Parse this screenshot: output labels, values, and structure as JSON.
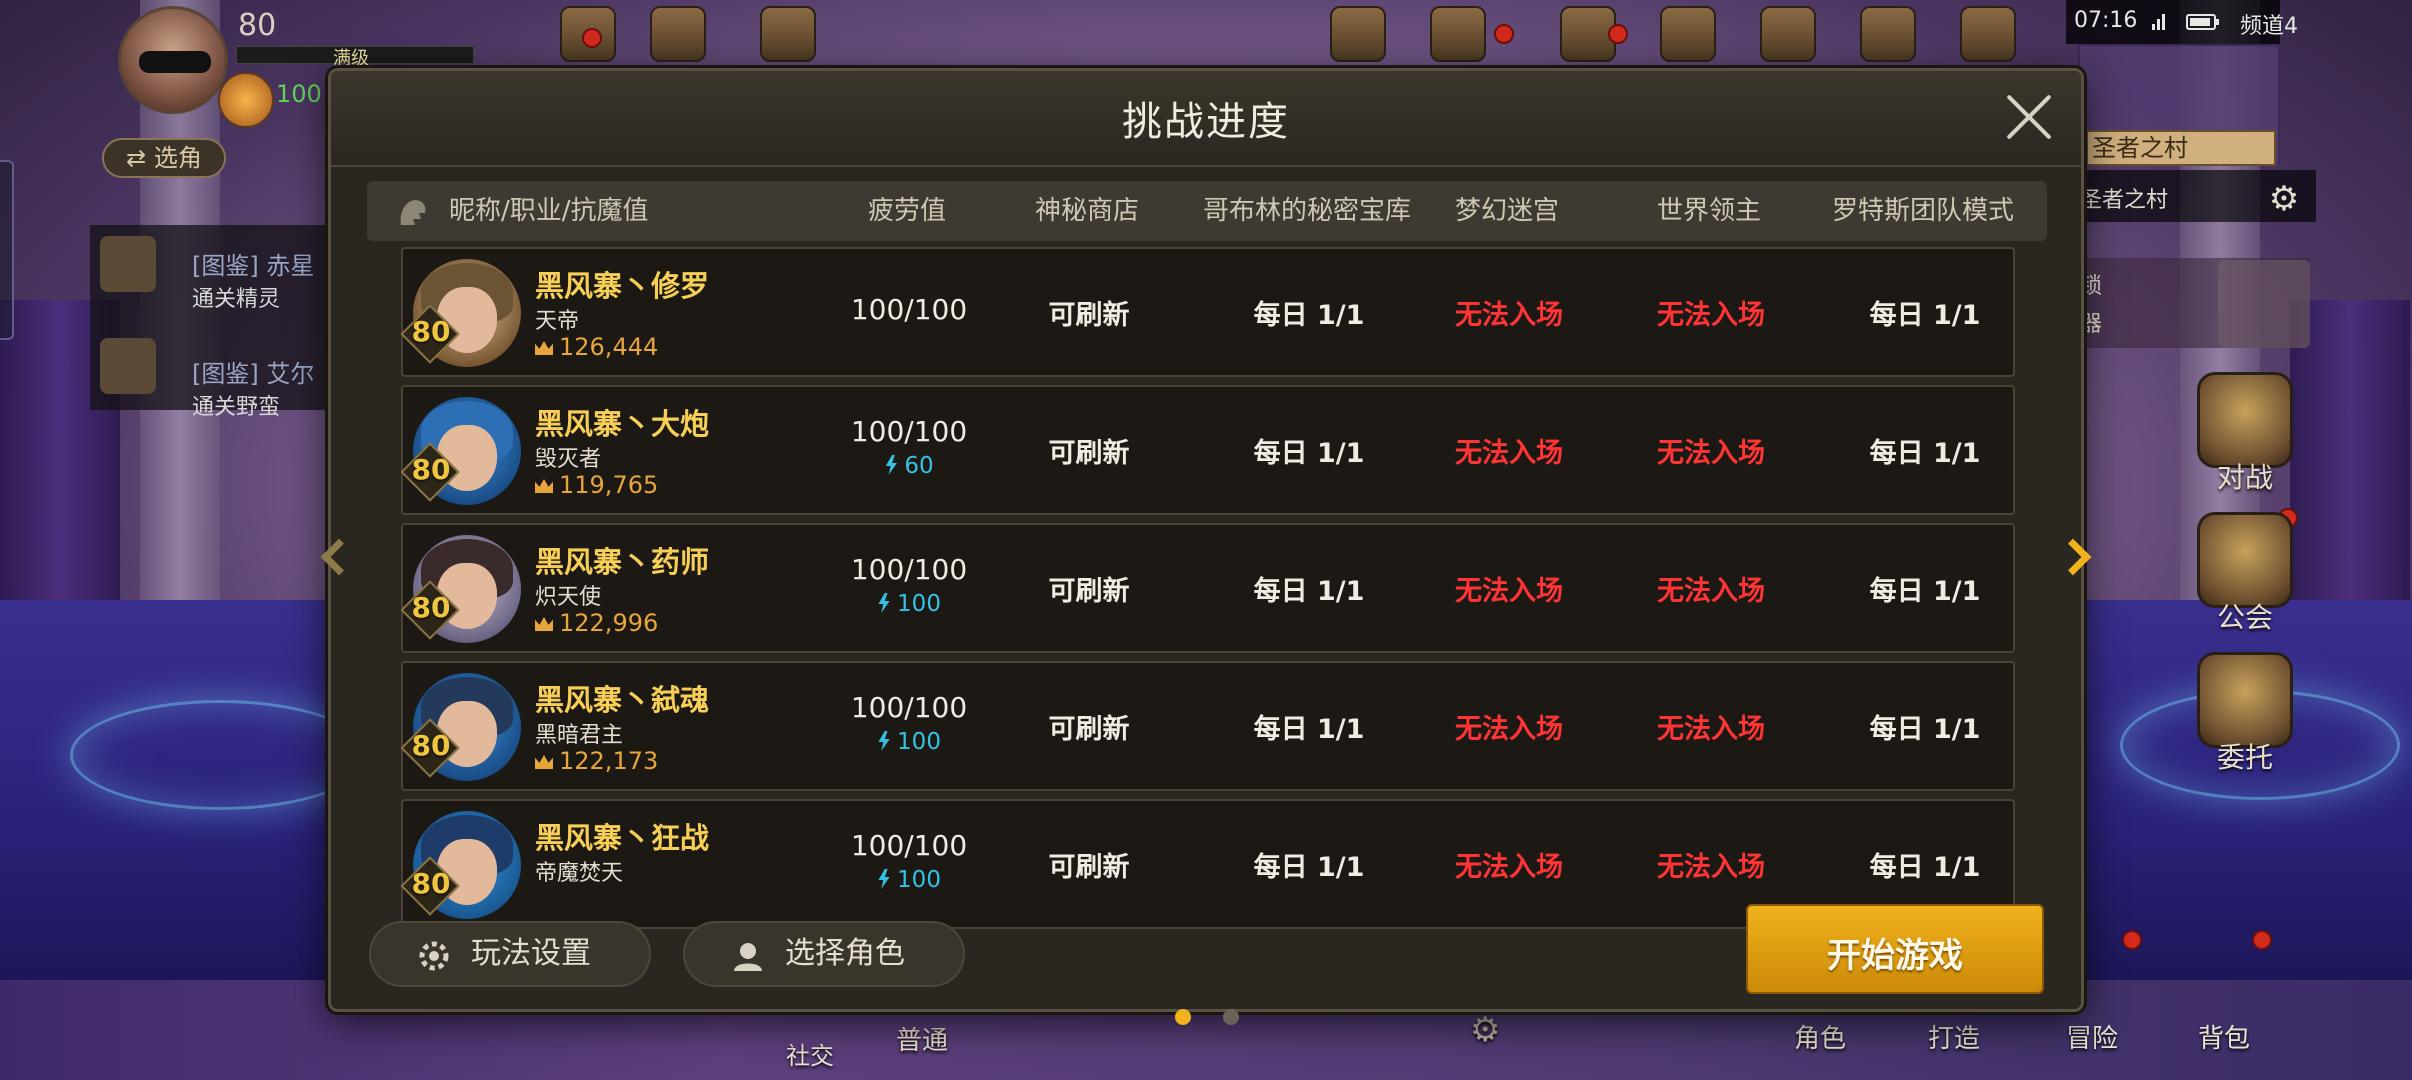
{
  "hud": {
    "level": "80",
    "max_level_label": "满级",
    "fatigue": "100",
    "switch_label": "⇄ 选角",
    "side_items": [
      {
        "title": "[图鉴] 赤星",
        "sub": "通关精灵"
      },
      {
        "title": "[图鉴] 艾尔",
        "sub": "通关野蛮"
      }
    ]
  },
  "status": {
    "time": "07:16",
    "channel": "频道4"
  },
  "minimap": {
    "sign": "圣者之村",
    "village": "圣者之村"
  },
  "quest_lines": [
    "锁",
    "器"
  ],
  "right_menu": [
    {
      "label": "对战",
      "icon": "swords-icon"
    },
    {
      "label": "公会",
      "icon": "guild-icon"
    },
    {
      "label": "委托",
      "icon": "board-icon"
    }
  ],
  "bottom_menu": [
    "社交",
    "普通",
    "角色",
    "打造",
    "冒险",
    "背包"
  ],
  "dialog": {
    "title": "挑战进度",
    "columns": {
      "character": "昵称/职业/抗魔值",
      "fatigue": "疲劳值",
      "shop": "神秘商店",
      "goblin": "哥布林的秘密宝库",
      "maze": "梦幻迷宫",
      "boss": "世界领主",
      "raid": "罗特斯团队模式"
    },
    "rows": [
      {
        "name": "黑风寨丶修罗",
        "job": "天帝",
        "level": "80",
        "power": "126,444",
        "fatigue": "100/100",
        "bonus": "",
        "shop": "可刷新",
        "goblin": "每日 1/1",
        "maze": "无法入场",
        "boss": "无法入场",
        "raid": "每日 1/1"
      },
      {
        "name": "黑风寨丶大炮",
        "job": "毁灭者",
        "level": "80",
        "power": "119,765",
        "fatigue": "100/100",
        "bonus": "60",
        "shop": "可刷新",
        "goblin": "每日 1/1",
        "maze": "无法入场",
        "boss": "无法入场",
        "raid": "每日 1/1"
      },
      {
        "name": "黑风寨丶药师",
        "job": "炽天使",
        "level": "80",
        "power": "122,996",
        "fatigue": "100/100",
        "bonus": "100",
        "shop": "可刷新",
        "goblin": "每日 1/1",
        "maze": "无法入场",
        "boss": "无法入场",
        "raid": "每日 1/1"
      },
      {
        "name": "黑风寨丶弑魂",
        "job": "黑暗君主",
        "level": "80",
        "power": "122,173",
        "fatigue": "100/100",
        "bonus": "100",
        "shop": "可刷新",
        "goblin": "每日 1/1",
        "maze": "无法入场",
        "boss": "无法入场",
        "raid": "每日 1/1"
      },
      {
        "name": "黑风寨丶狂战",
        "job": "帝魔焚天",
        "level": "80",
        "power": "",
        "fatigue": "100/100",
        "bonus": "100",
        "shop": "可刷新",
        "goblin": "每日 1/1",
        "maze": "无法入场",
        "boss": "无法入场",
        "raid": "每日 1/1"
      }
    ],
    "footer": {
      "settings_label": "玩法设置",
      "select_label": "选择角色",
      "start_label": "开始游戏"
    },
    "page": {
      "current": 1,
      "total": 2
    }
  },
  "colors": {
    "name_gold": "#f7cf56",
    "power_orange": "#e7a53c",
    "locked_red": "#ff3434",
    "bonus_cyan": "#33c2e6",
    "start_button": "#e4a114"
  }
}
